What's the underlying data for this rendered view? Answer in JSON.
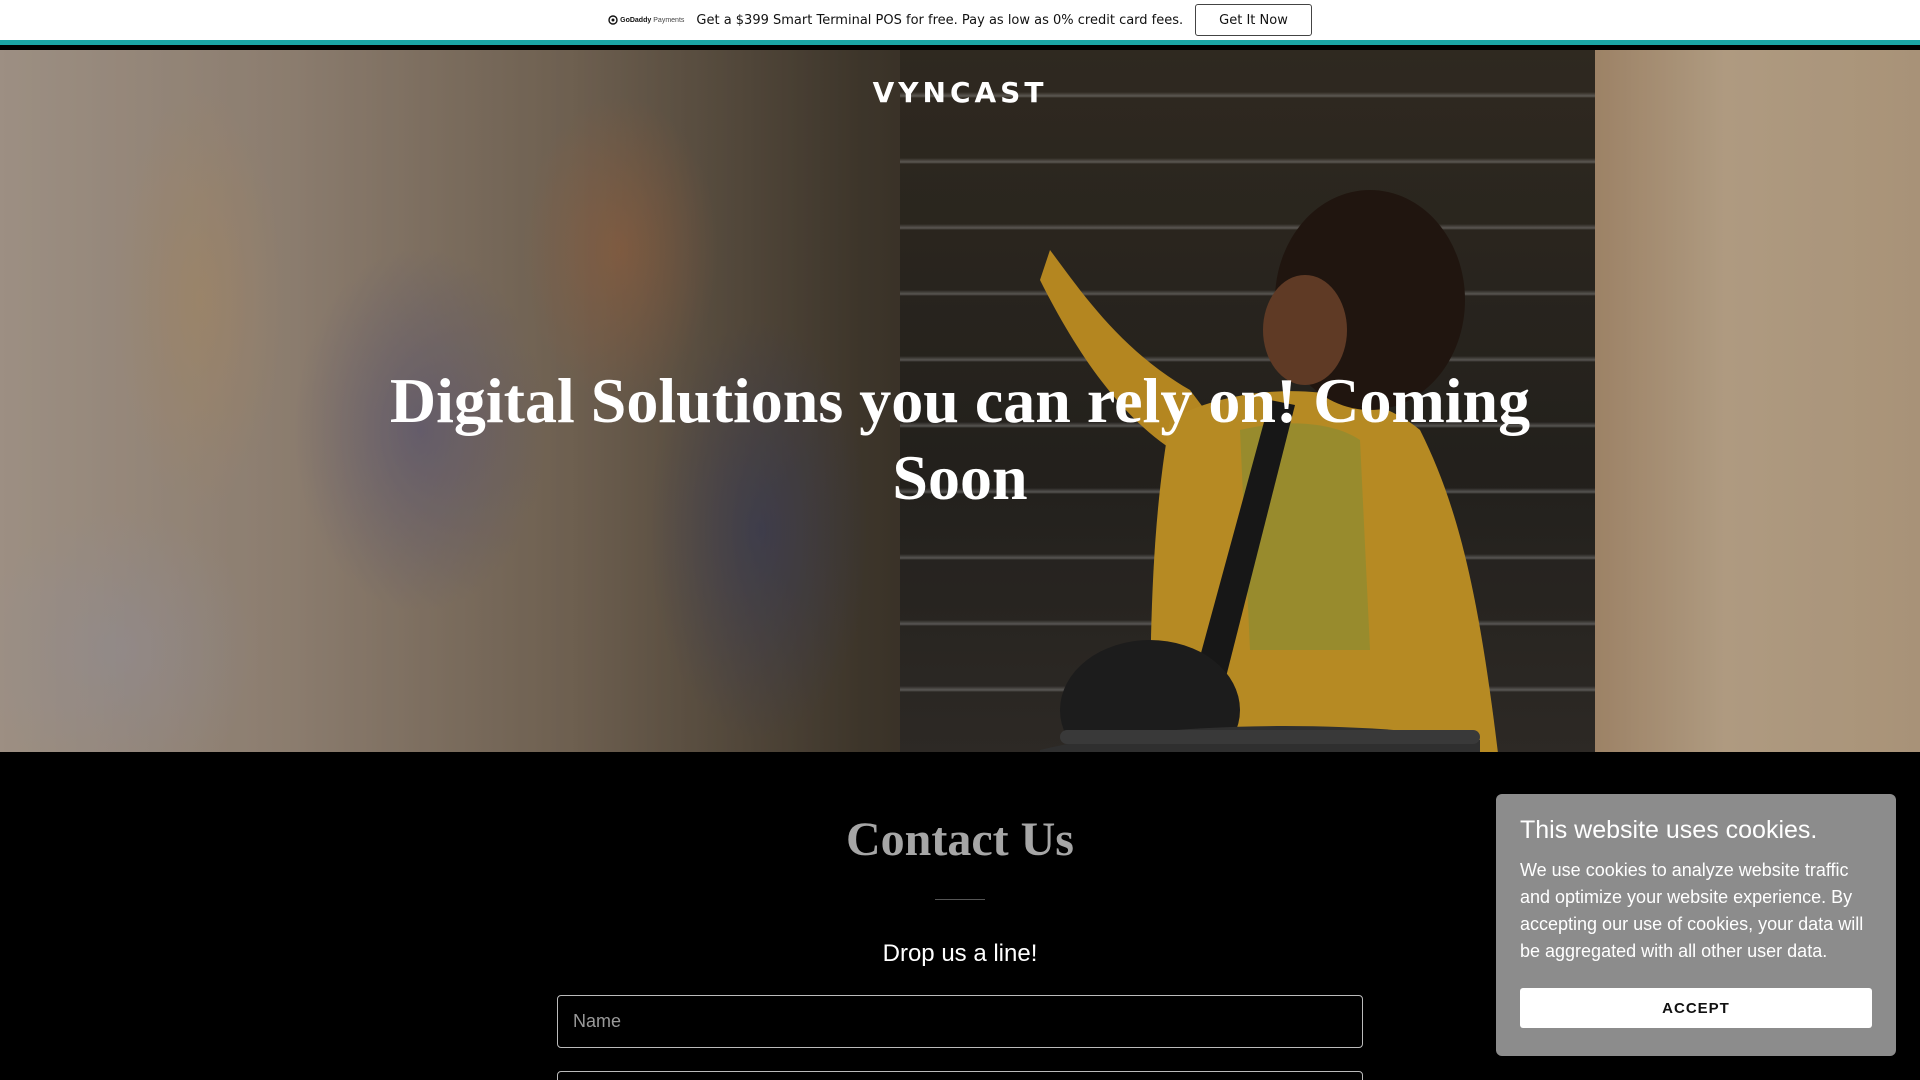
{
  "promo": {
    "logo_text_1": "GoDaddy",
    "logo_text_2": "Payments",
    "message": "Get a $399 Smart Terminal POS for free. Pay as low as 0% credit card fees.",
    "button_label": "Get It Now",
    "accent_color": "#1ba5a5"
  },
  "hero": {
    "brand": "VYNCAST",
    "title": "Digital Solutions you can rely on! Coming Soon"
  },
  "contact": {
    "title": "Contact Us",
    "subtitle": "Drop us a line!",
    "name_placeholder": "Name",
    "email_placeholder": ""
  },
  "cookie": {
    "title": "This website uses cookies.",
    "body": "We use cookies to analyze website traffic and optimize your website experience. By accepting our use of cookies, your data will be aggregated with all other user data.",
    "accept_label": "ACCEPT"
  }
}
